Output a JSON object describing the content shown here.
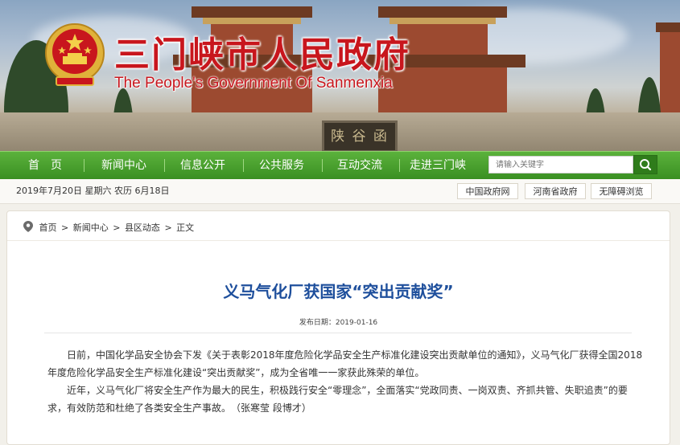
{
  "header": {
    "site_title": "三门峡市人民政府",
    "site_subtitle": "The People's Government Of Sanmenxia",
    "gate_sign": "陕 谷 函"
  },
  "nav": {
    "items": [
      "首　页",
      "新闻中心",
      "信息公开",
      "公共服务",
      "互动交流",
      "走进三门峡"
    ],
    "search_placeholder": "请输入关键字",
    "search_icon": "search-icon"
  },
  "infobar": {
    "date": "2019年7月20日 星期六 农历 6月18日",
    "links": [
      "中国政府网",
      "河南省政府",
      "无障碍浏览"
    ]
  },
  "breadcrumb": {
    "items": [
      "首页",
      "新闻中心",
      "县区动态",
      "正文"
    ],
    "separator": ">"
  },
  "article": {
    "title": "义马气化厂获国家“突出贡献奖”",
    "date_label": "发布日期：",
    "date": "2019-01-16",
    "paragraphs": [
      "日前，中国化学品安全协会下发《关于表彰2018年度危险化学品安全生产标准化建设突出贡献单位的通知》，义马气化厂获得全国2018年度危险化学品安全生产标准化建设“突出贡献奖”，成为全省唯一一家获此殊荣的单位。",
      "近年，义马气化厂将安全生产作为最大的民生，积极践行安全“零理念”，全面落实“党政同责、一岗双责、齐抓共管、失职追责”的要求，有效防范和杜绝了各类安全生产事故。　（张寒莹 段博才）"
    ]
  },
  "colors": {
    "title_red": "#c8161d",
    "nav_green": "#4aa02e",
    "article_title_blue": "#1e4f9c"
  }
}
